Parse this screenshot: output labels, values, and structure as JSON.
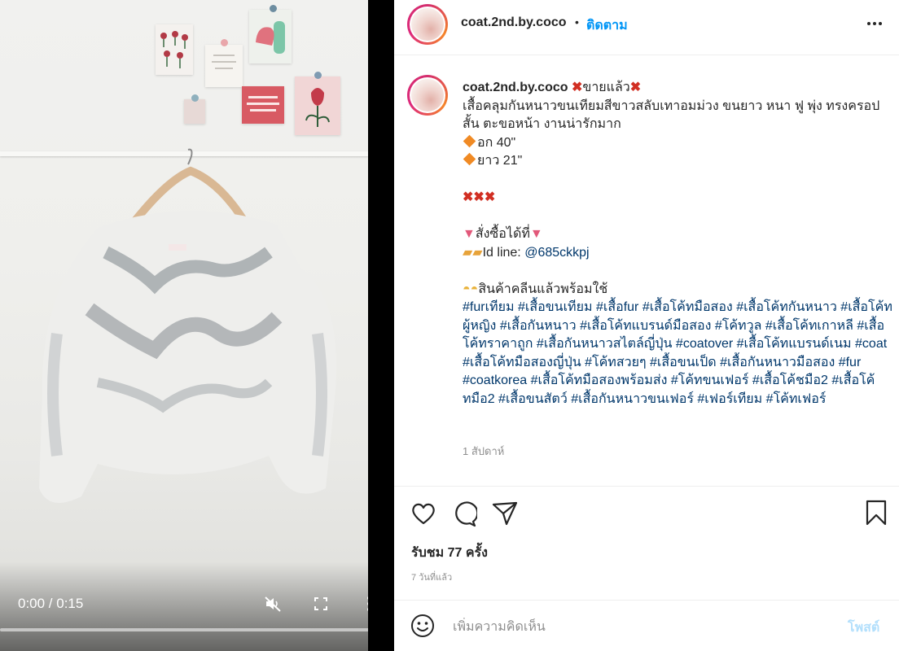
{
  "video": {
    "time": "0:00 / 0:15",
    "progress": 0,
    "controls": [
      "mute-icon",
      "fullscreen-icon",
      "more-vertical-icon"
    ]
  },
  "header": {
    "username": "coat.2nd.by.coco",
    "dot": "•",
    "follow_label": "ติดตาม",
    "more_icon": "more-horizontal-icon"
  },
  "caption": {
    "username": "coat.2nd.by.coco",
    "sold_label": "ขายแล้ว",
    "description": "เสื้อคลุมกันหนาวขนเทียมสีขาวสลับเทาอมม่วง ขนยาว หนา ฟู พุ่ง ทรงครอปสั้น ตะขอหน้า งานน่ารักมาก",
    "chest": "อก 40\"",
    "length": "ยาว 21\"",
    "order_label": "สั่งซื้อได้ที่",
    "line_prefix": "Id line: ",
    "line_id": "@685ckkpj",
    "clean_label": "สินค้าคลีนแล้วพร้อมใช้",
    "hashtags": "#furเทียม #เสื้อขนเทียม #เสื้อfur #เสื้อโค้ทมือสอง #เสื้อโค้ทกันหนาว #เสื้อโค้ทผู้หญิง #เสื้อกันหนาว #เสื้อโค้ทแบรนด์มือสอง #โค้ทวูล #เสื้อโค้ทเกาหลี #เสื้อโค้ทราคาถูก #เสื้อกันหนาวสไตล์ญี่ปุ่น #coatover #เสื้อโค้ทแบรนด์เนม #coat #เสื้อโค้ทมือสองญี่ปุ่น #โค้ทสวยๆ #เสื้อขนเป็ด #เสื้อกันหนาวมือสอง #fur #coatkorea #เสื้อโค้ทมือสองพร้อมส่ง #โค้ทขนเฟอร์ #เสื้อโค้ชมือ2 #เสื้อโค้ทมือ2 #เสื้อขนสัตว์ #เสื้อกันหนาวขนเฟอร์ #เฟอร์เทียม #โค้ทเฟอร์",
    "time": "1 สัปดาห์"
  },
  "actions": {
    "like_icon": "heart-icon",
    "comment_icon": "comment-icon",
    "share_icon": "share-icon",
    "save_icon": "bookmark-icon"
  },
  "stats": {
    "views": "รับชม 77 ครั้ง",
    "date": "7 วันที่แล้ว"
  },
  "comment": {
    "emoji_icon": "emoji-icon",
    "placeholder": "เพิ่มความคิดเห็น",
    "post_label": "โพสต์"
  },
  "colors": {
    "accent": "#0095f6",
    "hashtag": "#00376b",
    "muted": "#8e8e8e",
    "post_disabled": "#b2dffc",
    "sold_x": "#d12f23"
  }
}
